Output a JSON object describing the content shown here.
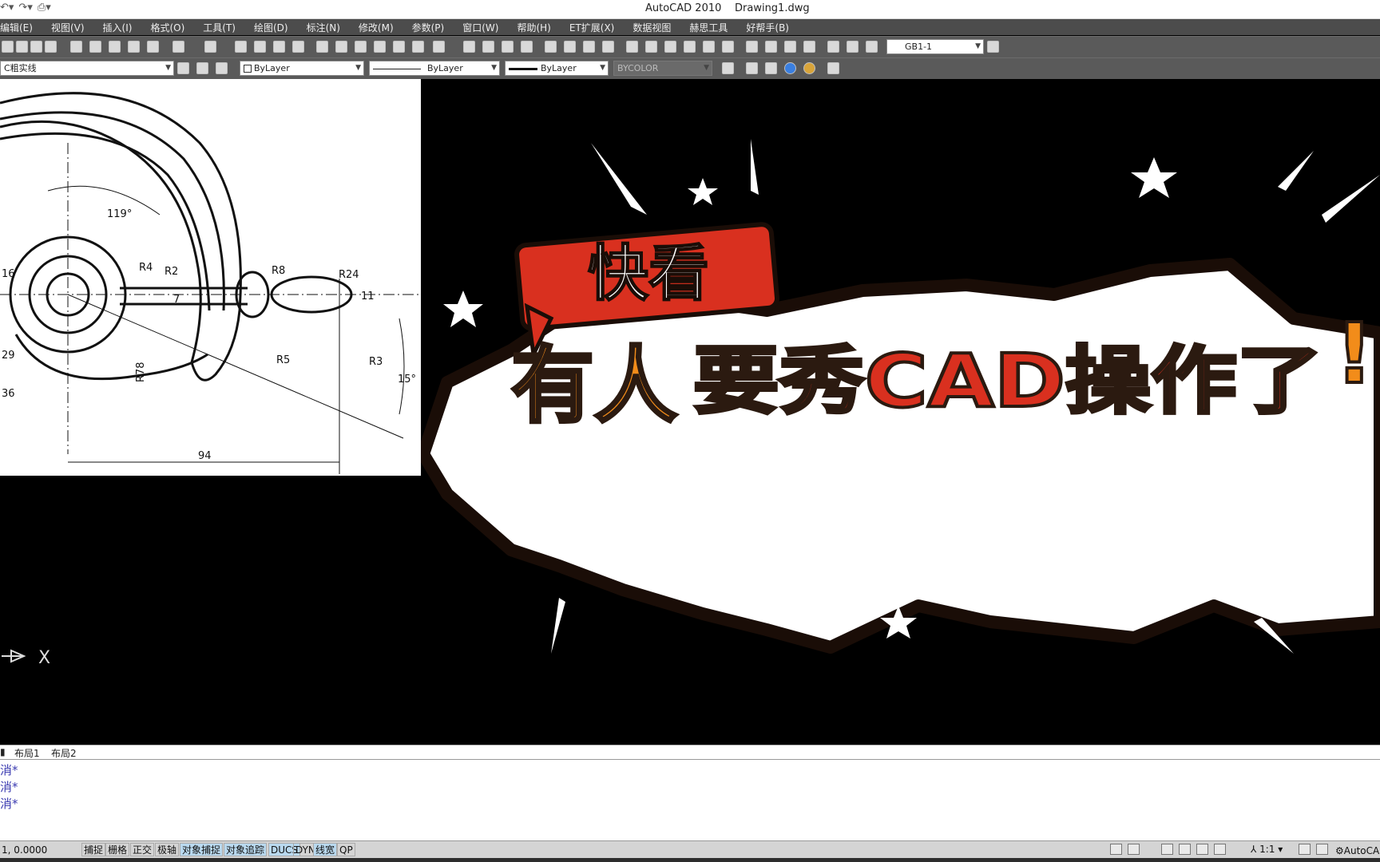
{
  "window": {
    "app_title": "AutoCAD 2010",
    "file_name": "Drawing1.dwg"
  },
  "menu": [
    "编辑(E)",
    "视图(V)",
    "插入(I)",
    "格式(O)",
    "工具(T)",
    "绘图(D)",
    "标注(N)",
    "修改(M)",
    "参数(P)",
    "窗口(W)",
    "帮助(H)",
    "ET扩展(X)",
    "数据视图",
    "赫思工具",
    "好帮手(B)"
  ],
  "toolbar": {
    "dim_style": "GB1-1"
  },
  "properties": {
    "layer": "C粗实线",
    "color": "ByLayer",
    "linetype": "ByLayer",
    "lineweight": "ByLayer",
    "plot_style": "BYCOLOR"
  },
  "drawing_dims": {
    "angle": "119°",
    "r4": "R4",
    "r2": "R2",
    "r8": "R8",
    "r24": "R24",
    "r5": "R5",
    "r3": "R3",
    "r78": "R78",
    "d16": "16",
    "d29": "29",
    "d36": "36",
    "eleven": "11",
    "seven": "7",
    "angle15": "15°",
    "width94": "94"
  },
  "banner": {
    "tag": "快看",
    "headline_orange": "有人",
    "headline_red": "要秀CAD操作了",
    "exclaim": "!!"
  },
  "layout_tabs": [
    "布局1",
    "布局2"
  ],
  "command_history": [
    "消*",
    "消*",
    "消*"
  ],
  "status": {
    "coordinates": "1, 0.0000",
    "toggles": [
      {
        "label": "捕捉",
        "on": false
      },
      {
        "label": "栅格",
        "on": false
      },
      {
        "label": "正交",
        "on": false
      },
      {
        "label": "极轴",
        "on": false
      },
      {
        "label": "对象捕捉",
        "on": true
      },
      {
        "label": "对象追踪",
        "on": true
      },
      {
        "label": "DUCS",
        "on": true
      },
      {
        "label": "DYN",
        "on": false
      },
      {
        "label": "线宽",
        "on": true
      },
      {
        "label": "QP",
        "on": false
      }
    ],
    "scale": "1:1",
    "workspace": "AutoCAD经典"
  }
}
